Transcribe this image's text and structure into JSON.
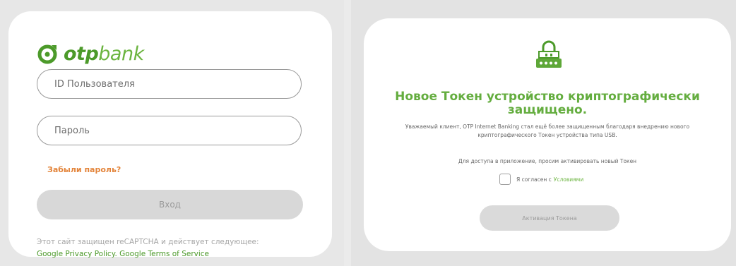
{
  "login": {
    "brand": {
      "otp": "otp",
      "bank": "bank"
    },
    "user_id_placeholder": "ID Пользователя",
    "password_placeholder": "Пароль",
    "forgot_password": "Забыли пароль?",
    "login_button": "Вход",
    "captcha_text": "Этот сайт защищен reCAPTCHA и действует следующее:",
    "privacy_link": "Google Privacy Policy",
    "terms_link": "Google Terms of Service"
  },
  "token": {
    "icon": "lock-usb-icon",
    "title": "Новое Токен устройство криптографически защищено.",
    "description": "Уважаемый клиент, OTP Internet Banking стал ещё более защищенным благодаря внедрению нового криптографического Токен устройства типа USB.",
    "access_text": "Для доступа в приложение, просим активировать новый Токен",
    "agree_text": "Я согласен с",
    "agree_link": "Условиями",
    "activate_button": "Активация Токена"
  },
  "colors": {
    "brand_green": "#4c9a2a",
    "light_green": "#6bb43f",
    "accent_orange": "#e3843a"
  }
}
